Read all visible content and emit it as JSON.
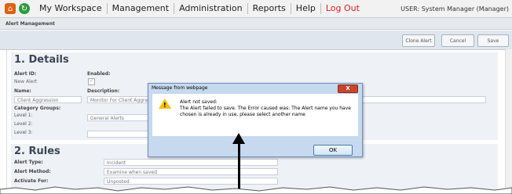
{
  "nav": {
    "workspace": "My Workspace",
    "management": "Management",
    "administration": "Administration",
    "reports": "Reports",
    "help": "Help",
    "logout": "Log Out",
    "user": "USER: System Manager (Manager)"
  },
  "breadcrumb": "Alert Management",
  "toolbar": {
    "clone": "Clone Alert",
    "cancel": "Cancel",
    "save": "Save"
  },
  "details": {
    "title": "1. Details",
    "alert_id_label": "Alert ID:",
    "alert_id_value": "New Alert",
    "enabled_label": "Enabled:",
    "name_label": "Name:",
    "name_value": "Client Aggression",
    "description_label": "Description:",
    "description_value": "Monitor For Client Aggres",
    "category_label": "Category Groups:",
    "level1_label": "Level 1:",
    "level1_value": "General Alerts",
    "level2_label": "Level 2:",
    "level3_label": "Level 3:"
  },
  "rules": {
    "title": "2. Rules",
    "type_label": "Alert Type:",
    "type_value": "Incident",
    "method_label": "Alert Method:",
    "method_value": "Examine when saved",
    "activate_label": "Activate For:",
    "activate_value": "Unposted"
  },
  "dialog": {
    "title": "Message from webpage",
    "close": "X",
    "line1": "Alert not saved:",
    "line2": "The Alert failed to save. The Error caused was: The Alert name you have chosen is already in use, please select another name",
    "ok": "OK"
  }
}
